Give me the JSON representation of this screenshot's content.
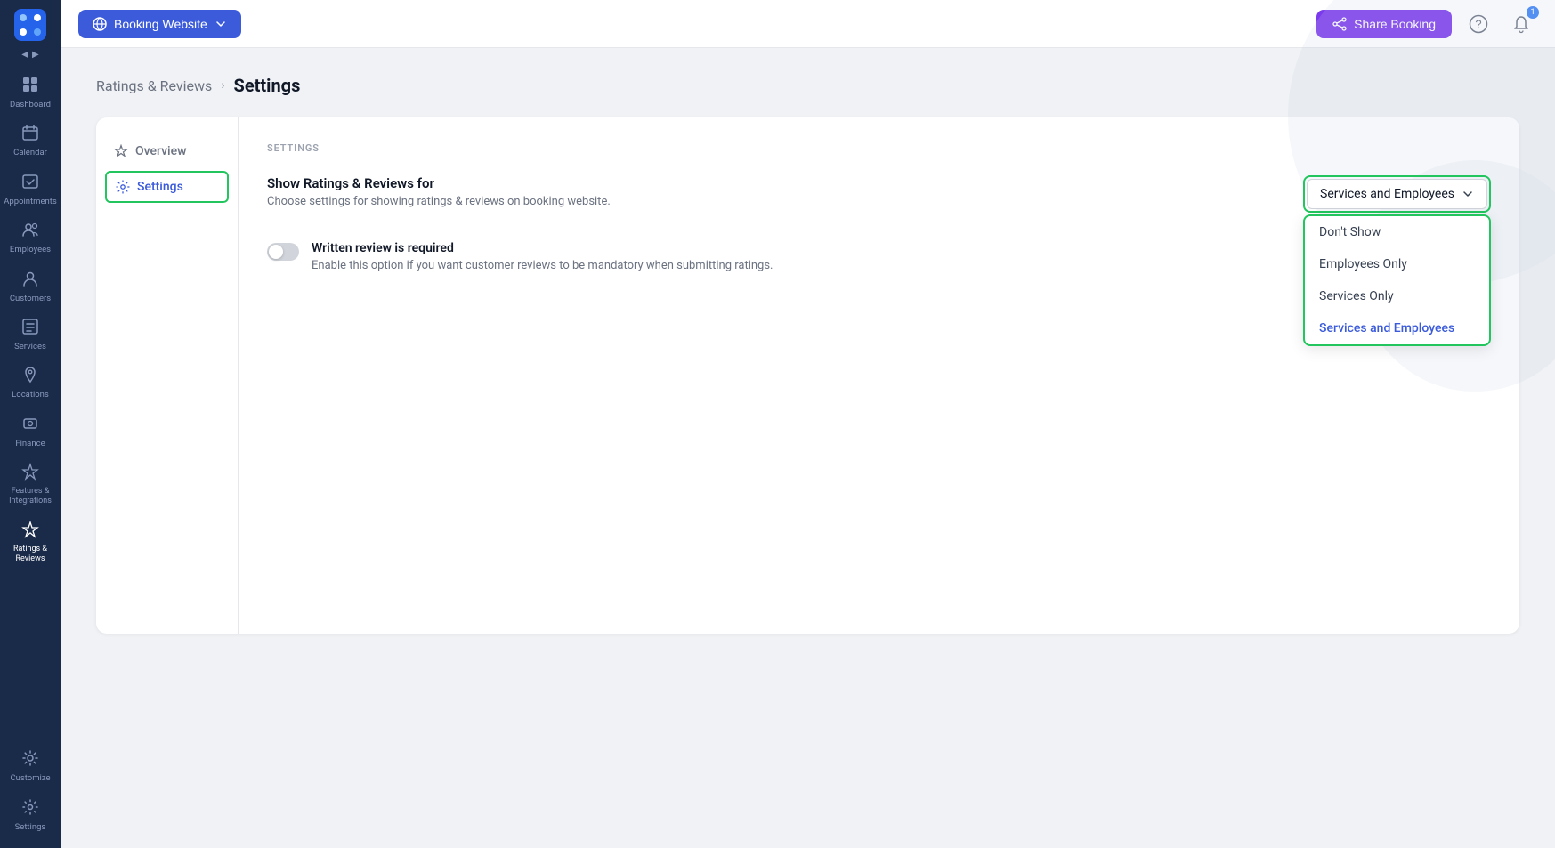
{
  "sidebar": {
    "items": [
      {
        "id": "dashboard",
        "label": "Dashboard",
        "icon": "⊞"
      },
      {
        "id": "calendar",
        "label": "Calendar",
        "icon": "📅"
      },
      {
        "id": "appointments",
        "label": "Appointments",
        "icon": "✅"
      },
      {
        "id": "employees",
        "label": "Employees",
        "icon": "👥"
      },
      {
        "id": "customers",
        "label": "Customers",
        "icon": "👤"
      },
      {
        "id": "services",
        "label": "Services",
        "icon": "🏷️"
      },
      {
        "id": "locations",
        "label": "Locations",
        "icon": "📍"
      },
      {
        "id": "finance",
        "label": "Finance",
        "icon": "📷"
      },
      {
        "id": "features",
        "label": "Features &\nIntegrations",
        "icon": "⚡"
      },
      {
        "id": "ratings",
        "label": "Ratings &\nReviews",
        "icon": "⭐"
      }
    ],
    "bottom_items": [
      {
        "id": "customize",
        "label": "Customize",
        "icon": "🎨"
      },
      {
        "id": "settings",
        "label": "Settings",
        "icon": "⚙️"
      }
    ]
  },
  "topbar": {
    "booking_website_label": "Booking Website",
    "share_booking_label": "Share Booking",
    "notification_count": "1"
  },
  "breadcrumb": {
    "parent": "Ratings & Reviews",
    "separator": "›",
    "current": "Settings"
  },
  "settings_nav": {
    "items": [
      {
        "id": "overview",
        "label": "Overview",
        "active": false
      },
      {
        "id": "settings",
        "label": "Settings",
        "active": true
      }
    ]
  },
  "settings_section": {
    "title": "SETTINGS",
    "show_ratings_label": "Show Ratings & Reviews for",
    "show_ratings_desc": "Choose settings for showing ratings & reviews on booking website.",
    "dropdown": {
      "selected": "Services and Employees",
      "options": [
        {
          "id": "dont-show",
          "label": "Don't Show",
          "selected": false
        },
        {
          "id": "employees-only",
          "label": "Employees Only",
          "selected": false
        },
        {
          "id": "services-only",
          "label": "Services Only",
          "selected": false
        },
        {
          "id": "services-and-employees",
          "label": "Services and Employees",
          "selected": true
        }
      ]
    },
    "written_review_label": "Written review is required",
    "written_review_desc": "Enable this option if you want customer reviews to be mandatory when submitting ratings."
  }
}
